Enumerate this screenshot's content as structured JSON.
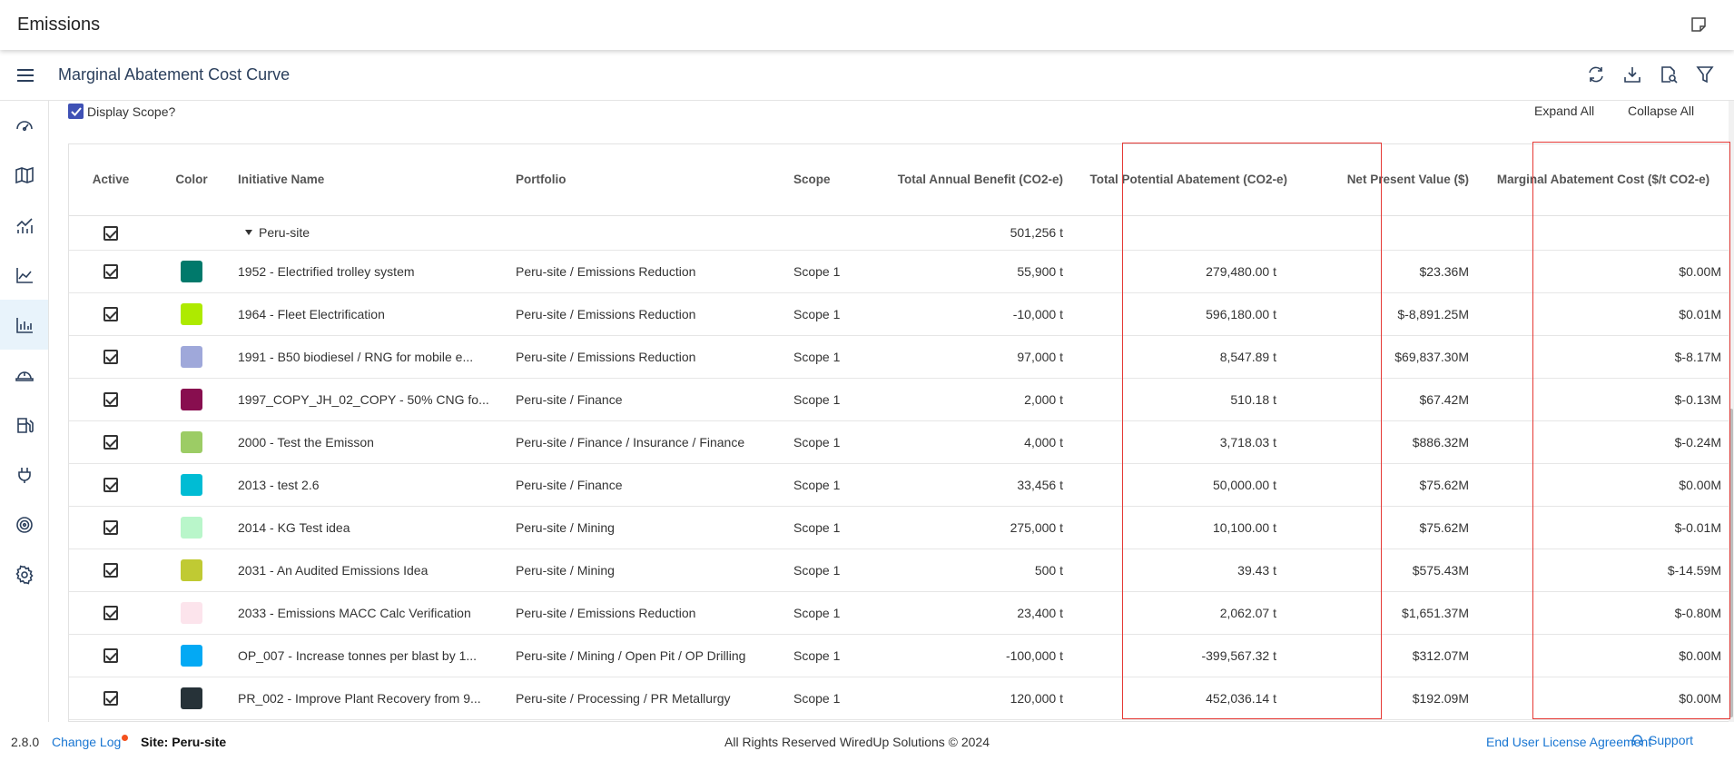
{
  "app": {
    "title": "Emissions"
  },
  "header": {
    "page_title": "Marginal Abatement Cost Curve"
  },
  "controls": {
    "display_scope_label": "Display Scope?",
    "display_scope_checked": true,
    "expand_all": "Expand All",
    "collapse_all": "Collapse All"
  },
  "toolbar_icons": [
    "refresh-icon",
    "download-icon",
    "search-document-icon",
    "filter-icon"
  ],
  "sidebar_icons": [
    "dashboard-icon",
    "map-icon",
    "line-chart-icon",
    "area-chart-icon",
    "bar-chart-icon",
    "helmet-icon",
    "fuel-station-icon",
    "plug-icon",
    "target-icon",
    "settings-icon"
  ],
  "sidebar_active_index": 4,
  "columns": {
    "active": "Active",
    "color": "Color",
    "initiative": "Initiative Name",
    "portfolio": "Portfolio",
    "scope": "Scope",
    "annual_benefit": "Total Annual Benefit (CO2-e)",
    "potential_abatement": "Total Potential Abatement (CO2-e)",
    "npv": "Net Present Value ($)",
    "mac": "Marginal Abatement Cost ($/t CO2-e)"
  },
  "group": {
    "name": "Peru-site",
    "annual_benefit": "501,256 t"
  },
  "rows": [
    {
      "color": "#00796b",
      "initiative": "1952 - Electrified trolley system",
      "portfolio": "Peru-site / Emissions Reduction",
      "scope": "Scope 1",
      "annual_benefit": "55,900 t",
      "potential_abatement": "279,480.00 t",
      "npv": "$23.36M",
      "mac": "$0.00M"
    },
    {
      "color": "#aeea00",
      "initiative": "1964 - Fleet Electrification",
      "portfolio": "Peru-site / Emissions Reduction",
      "scope": "Scope 1",
      "annual_benefit": "-10,000 t",
      "potential_abatement": "596,180.00 t",
      "npv": "$-8,891.25M",
      "mac": "$0.01M"
    },
    {
      "color": "#9fa8da",
      "initiative": "1991 - B50 biodiesel / RNG for mobile e...",
      "portfolio": "Peru-site / Emissions Reduction",
      "scope": "Scope 1",
      "annual_benefit": "97,000 t",
      "potential_abatement": "8,547.89 t",
      "npv": "$69,837.30M",
      "mac": "$-8.17M"
    },
    {
      "color": "#880e4f",
      "initiative": "1997_COPY_JH_02_COPY - 50% CNG fo...",
      "portfolio": "Peru-site / Finance",
      "scope": "Scope 1",
      "annual_benefit": "2,000 t",
      "potential_abatement": "510.18 t",
      "npv": "$67.42M",
      "mac": "$-0.13M"
    },
    {
      "color": "#9ccc65",
      "initiative": "2000 - Test the Emisson",
      "portfolio": "Peru-site / Finance / Insurance / Finance",
      "scope": "Scope 1",
      "annual_benefit": "4,000 t",
      "potential_abatement": "3,718.03 t",
      "npv": "$886.32M",
      "mac": "$-0.24M"
    },
    {
      "color": "#00bcd4",
      "initiative": "2013 - test 2.6",
      "portfolio": "Peru-site / Finance",
      "scope": "Scope 1",
      "annual_benefit": "33,456 t",
      "potential_abatement": "50,000.00 t",
      "npv": "$75.62M",
      "mac": "$0.00M"
    },
    {
      "color": "#b9f6ca",
      "initiative": "2014 - KG Test idea",
      "portfolio": "Peru-site / Mining",
      "scope": "Scope 1",
      "annual_benefit": "275,000 t",
      "potential_abatement": "10,100.00 t",
      "npv": "$75.62M",
      "mac": "$-0.01M"
    },
    {
      "color": "#c0ca33",
      "initiative": "2031 - An Audited Emissions Idea",
      "portfolio": "Peru-site / Mining",
      "scope": "Scope 1",
      "annual_benefit": "500 t",
      "potential_abatement": "39.43 t",
      "npv": "$575.43M",
      "mac": "$-14.59M"
    },
    {
      "color": "#fce4ec",
      "initiative": "2033 - Emissions MACC Calc Verification",
      "portfolio": "Peru-site / Emissions Reduction",
      "scope": "Scope 1",
      "annual_benefit": "23,400 t",
      "potential_abatement": "2,062.07 t",
      "npv": "$1,651.37M",
      "mac": "$-0.80M"
    },
    {
      "color": "#03a9f4",
      "initiative": "OP_007 - Increase tonnes per blast by 1...",
      "portfolio": "Peru-site / Mining / Open Pit / OP Drilling",
      "scope": "Scope 1",
      "annual_benefit": "-100,000 t",
      "potential_abatement": "-399,567.32 t",
      "npv": "$312.07M",
      "mac": "$0.00M"
    },
    {
      "color": "#263238",
      "initiative": "PR_002 - Improve Plant Recovery from 9...",
      "portfolio": "Peru-site / Processing / PR Metallurgy",
      "scope": "Scope 1",
      "annual_benefit": "120,000 t",
      "potential_abatement": "452,036.14 t",
      "npv": "$192.09M",
      "mac": "$0.00M"
    }
  ],
  "footer": {
    "version": "2.8.0",
    "change_log": "Change Log",
    "site": "Site: Peru-site",
    "copyright": "All Rights Reserved WiredUp Solutions © 2024",
    "eula": "End User License Agreement",
    "support": "Support"
  },
  "colors": {
    "accent": "#3f51b5",
    "link": "#1976d2",
    "highlight_box": "#e53935",
    "active_nav_bg": "#e8f3fb"
  }
}
